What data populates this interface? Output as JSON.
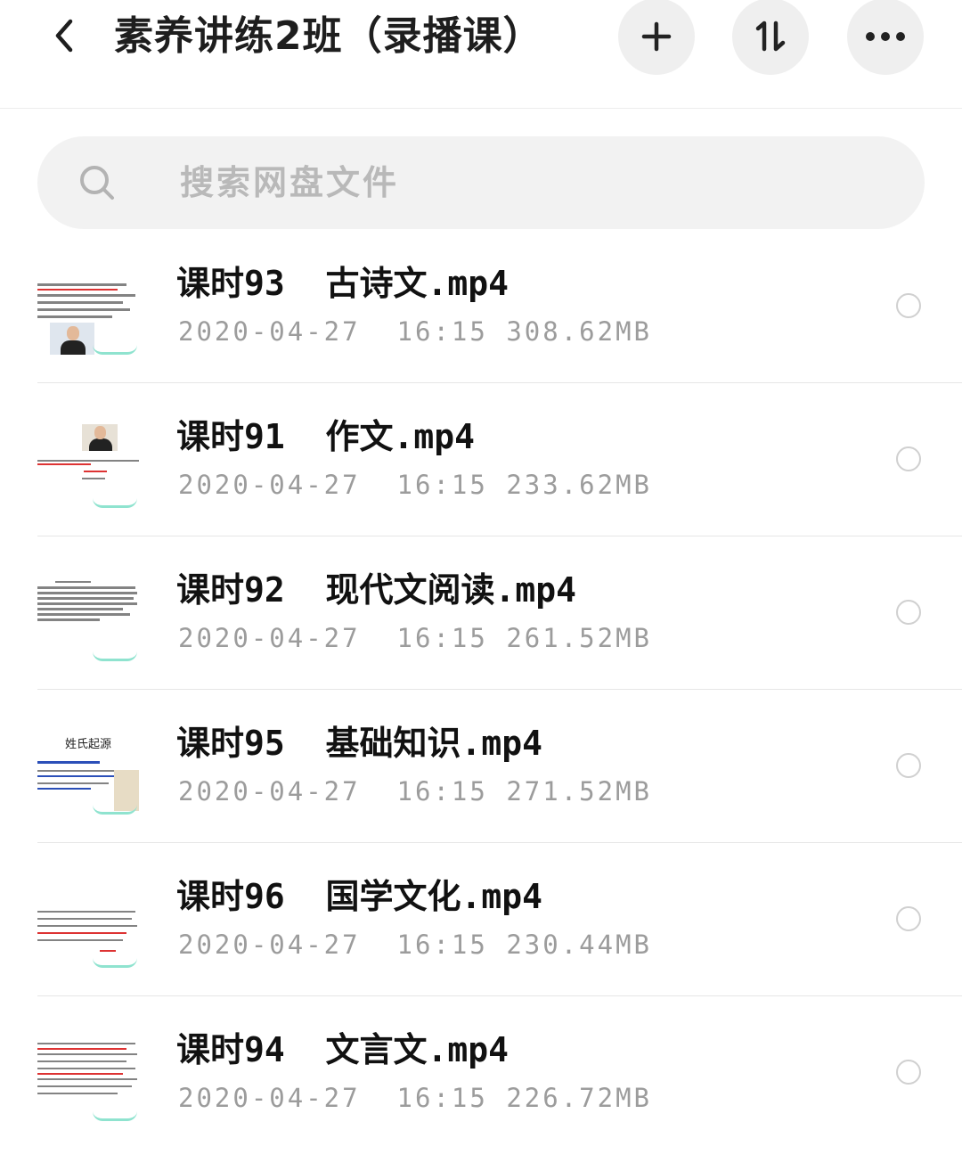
{
  "header": {
    "title": "素养讲练2班（录播课）",
    "back_icon": "chevron-left-icon",
    "actions": [
      {
        "name": "add-icon",
        "glyph": "+"
      },
      {
        "name": "sort-icon",
        "glyph": "⇅"
      },
      {
        "name": "more-icon",
        "glyph": "…"
      }
    ]
  },
  "search": {
    "placeholder": "搜索网盘文件",
    "icon": "search-icon"
  },
  "files": [
    {
      "name": "课时93  古诗文.mp4",
      "date": "2020-04-27",
      "time": "16:15",
      "size": "308.62MB",
      "thumb_caption": ""
    },
    {
      "name": "课时91  作文.mp4",
      "date": "2020-04-27",
      "time": "16:15",
      "size": "233.62MB",
      "thumb_caption": ""
    },
    {
      "name": "课时92  现代文阅读.mp4",
      "date": "2020-04-27",
      "time": "16:15",
      "size": "261.52MB",
      "thumb_caption": ""
    },
    {
      "name": "课时95  基础知识.mp4",
      "date": "2020-04-27",
      "time": "16:15",
      "size": "271.52MB",
      "thumb_caption": "姓氏起源"
    },
    {
      "name": "课时96  国学文化.mp4",
      "date": "2020-04-27",
      "time": "16:15",
      "size": "230.44MB",
      "thumb_caption": ""
    },
    {
      "name": "课时94  文言文.mp4",
      "date": "2020-04-27",
      "time": "16:15",
      "size": "226.72MB",
      "thumb_caption": ""
    }
  ],
  "colors": {
    "title": "#1e1e1e",
    "meta": "#9c9c9c",
    "button_bg": "#efefef",
    "search_bg": "#f2f2f2",
    "placeholder": "#b9b9b9"
  }
}
